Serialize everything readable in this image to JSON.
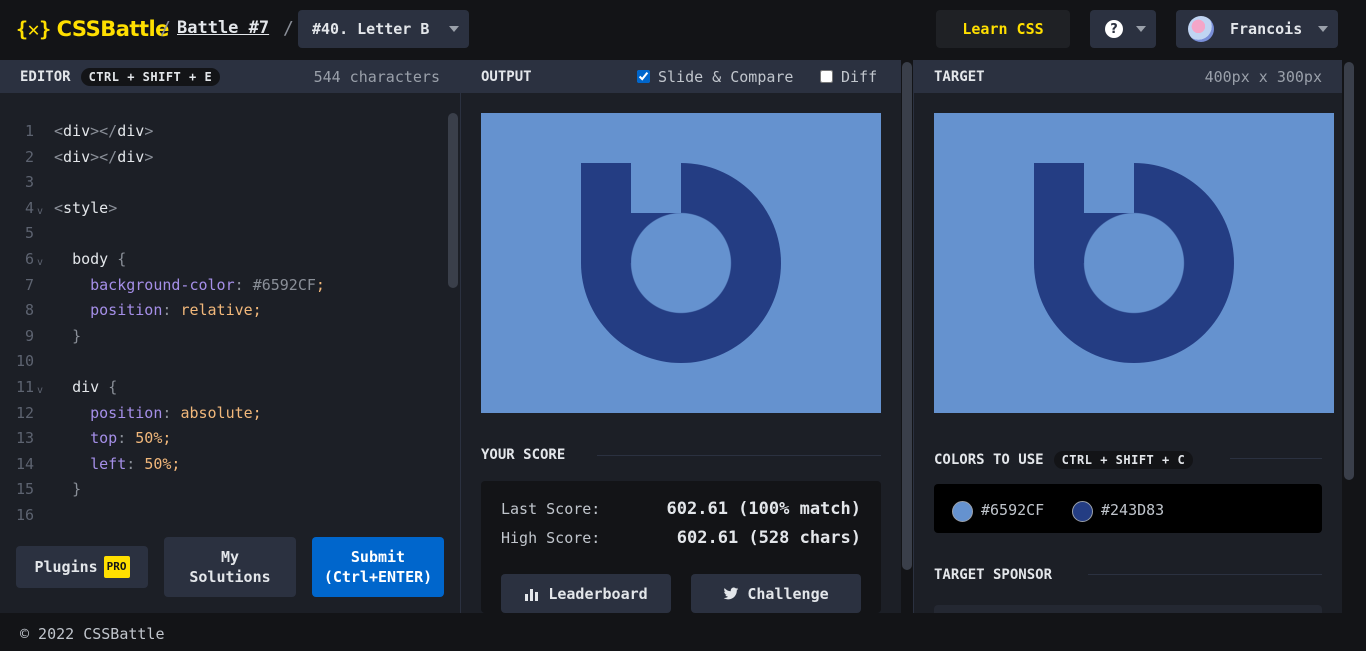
{
  "header": {
    "logo_mark": "{✕}",
    "logo_text": "CSSBattle",
    "separator": "/",
    "battle_link": "Battle #7",
    "target_selected": "#40. Letter B",
    "learn_label": "Learn CSS",
    "help_symbol": "?",
    "user_name": "Francois"
  },
  "editor": {
    "title": "EDITOR",
    "shortcut": "CTRL + SHIFT + E",
    "char_count": "544 characters",
    "lines": [
      {
        "n": "1",
        "fold": "",
        "html": "<span class=\"t-punc\">&lt;</span><span class=\"t-tag\">div</span><span class=\"t-punc\">&gt;&lt;/</span><span class=\"t-tag\">div</span><span class=\"t-punc\">&gt;</span>"
      },
      {
        "n": "2",
        "fold": "",
        "html": "<span class=\"t-punc\">&lt;</span><span class=\"t-tag\">div</span><span class=\"t-punc\">&gt;&lt;/</span><span class=\"t-tag\">div</span><span class=\"t-punc\">&gt;</span>"
      },
      {
        "n": "3",
        "fold": "",
        "html": ""
      },
      {
        "n": "4",
        "fold": "v",
        "html": "<span class=\"t-punc\">&lt;</span><span class=\"t-tag\">style</span><span class=\"t-punc\">&gt;</span>"
      },
      {
        "n": "5",
        "fold": "",
        "html": ""
      },
      {
        "n": "6",
        "fold": "v",
        "html": "  <span class=\"t-tag\">body</span> <span class=\"t-punc\">{</span>"
      },
      {
        "n": "7",
        "fold": "",
        "html": "    <span class=\"t-prop\">background-color</span><span class=\"t-punc\">:</span> <span class=\"t-hex\">#6592CF</span><span class=\"t-val\">;</span>"
      },
      {
        "n": "8",
        "fold": "",
        "html": "    <span class=\"t-prop\">position</span><span class=\"t-punc\">:</span> <span class=\"t-val\">relative;</span>"
      },
      {
        "n": "9",
        "fold": "",
        "html": "  <span class=\"t-punc\">}</span>"
      },
      {
        "n": "10",
        "fold": "",
        "html": ""
      },
      {
        "n": "11",
        "fold": "v",
        "html": "  <span class=\"t-tag\">div</span> <span class=\"t-punc\">{</span>"
      },
      {
        "n": "12",
        "fold": "",
        "html": "    <span class=\"t-prop\">position</span><span class=\"t-punc\">:</span> <span class=\"t-val\">absolute;</span>"
      },
      {
        "n": "13",
        "fold": "",
        "html": "    <span class=\"t-prop\">top</span><span class=\"t-punc\">:</span> <span class=\"t-num\">50%;</span>"
      },
      {
        "n": "14",
        "fold": "",
        "html": "    <span class=\"t-prop\">left</span><span class=\"t-punc\">:</span> <span class=\"t-num\">50%;</span>"
      },
      {
        "n": "15",
        "fold": "",
        "html": "  <span class=\"t-punc\">}</span>"
      },
      {
        "n": "16",
        "fold": "",
        "html": ""
      }
    ],
    "plugins_label": "Plugins",
    "pro_badge": "PRO",
    "my_solutions_label": "My Solutions",
    "submit_label": "Submit",
    "submit_shortcut": "(Ctrl+ENTER)"
  },
  "output": {
    "title": "OUTPUT",
    "slide_compare_label": "Slide & Compare",
    "slide_compare_checked": true,
    "diff_label": "Diff",
    "diff_checked": false
  },
  "score": {
    "title": "YOUR SCORE",
    "last_label": "Last Score:",
    "last_value": "602.61 (100% match)",
    "high_label": "High Score:",
    "high_value": "602.61 (528 chars)",
    "leaderboard_label": "Leaderboard",
    "challenge_label": "Challenge"
  },
  "target": {
    "title": "TARGET",
    "dimensions": "400px x 300px",
    "colors_title": "COLORS TO USE",
    "colors_shortcut": "CTRL + SHIFT + C",
    "colors": [
      {
        "hex": "#6592CF",
        "swatch": "#6592cf"
      },
      {
        "hex": "#243D83",
        "swatch": "#243d83"
      }
    ],
    "sponsor_title": "TARGET SPONSOR"
  },
  "footer": {
    "copyright": "© 2022 CSSBattle"
  }
}
